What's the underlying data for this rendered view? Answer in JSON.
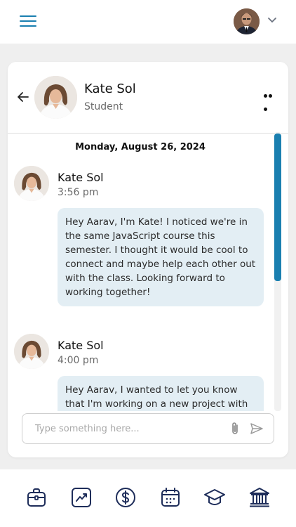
{
  "header": {
    "menu_icon": "hamburger-icon",
    "profile_icon": "user-avatar",
    "dropdown_icon": "chevron-down-icon"
  },
  "contact": {
    "name": "Kate Sol",
    "role": "Student"
  },
  "conversation": {
    "date": "Monday, August 26, 2024",
    "messages": [
      {
        "sender": "Kate Sol",
        "time": "3:56 pm",
        "text": "Hey Aarav, I'm Kate! I noticed we're in the same JavaScript course this semester. I thought it would be cool to connect and maybe help each other out with the class. Looking forward to working together!"
      },
      {
        "sender": "Kate Sol",
        "time": "4:00 pm",
        "text": "Hey Aarav, I wanted to let you know that I'm working on a new project with some"
      }
    ]
  },
  "composer": {
    "placeholder": "Type something here...",
    "value": ""
  },
  "colors": {
    "accent": "#1a7fb0",
    "bubble": "#e3eef4",
    "nav_icon": "#1e2d5a"
  },
  "bottom_nav": [
    "briefcase-icon",
    "trend-chart-icon",
    "dollar-icon",
    "calendar-icon",
    "graduation-cap-icon",
    "bank-icon"
  ]
}
